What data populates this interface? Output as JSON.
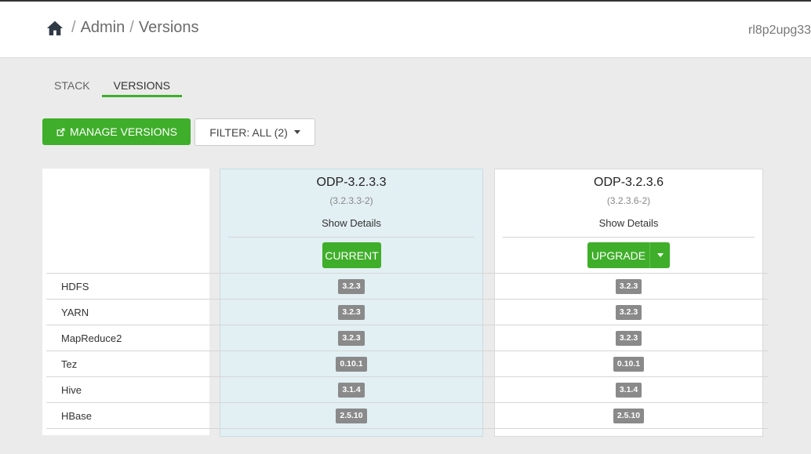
{
  "breadcrumb": {
    "admin": "Admin",
    "separator": "/",
    "page": "Versions"
  },
  "cluster_name": "rl8p2upg33",
  "tabs": [
    {
      "label": "STACK",
      "active": false
    },
    {
      "label": "VERSIONS",
      "active": true
    }
  ],
  "toolbar": {
    "manage_label": "MANAGE VERSIONS",
    "filter_label": "FILTER: ALL (2)"
  },
  "versions": [
    {
      "name": "ODP-3.2.3.3",
      "full": "(3.2.3.3-2)",
      "details_label": "Show Details",
      "action_label": "CURRENT",
      "is_current": true,
      "services": [
        "3.2.3",
        "3.2.3",
        "3.2.3",
        "0.10.1",
        "3.1.4",
        "2.5.10",
        ""
      ]
    },
    {
      "name": "ODP-3.2.3.6",
      "full": "(3.2.3.6-2)",
      "details_label": "Show Details",
      "action_label": "UPGRADE",
      "is_current": false,
      "services": [
        "3.2.3",
        "3.2.3",
        "3.2.3",
        "0.10.1",
        "3.1.4",
        "2.5.10",
        ""
      ]
    }
  ],
  "services": [
    "HDFS",
    "YARN",
    "MapReduce2",
    "Tez",
    "Hive",
    "HBase"
  ],
  "colors": {
    "accent": "#3fae2a",
    "current_column": "#e2eff3",
    "badge": "#8a8a8a"
  }
}
